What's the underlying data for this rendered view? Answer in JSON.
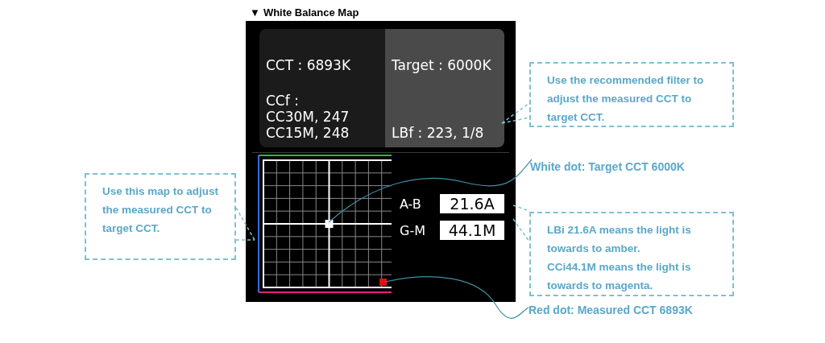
{
  "section": {
    "arrow": "▼",
    "title": "White Balance Map"
  },
  "readouts": [
    {
      "kind": "dark",
      "text": "CCT : 6893K"
    },
    {
      "kind": "light",
      "text": "Target : 6000K"
    },
    {
      "kind": "dark",
      "text": "CCf :\nCC30M, 247\nCC15M, 248"
    },
    {
      "kind": "light",
      "text": "LBf : 223, 1/8"
    }
  ],
  "axes": [
    {
      "label": "A-B",
      "value": "21.6A"
    },
    {
      "label": "G-M",
      "value": "44.1M"
    }
  ],
  "callouts": [
    {
      "kind": "box",
      "text": "Use the recommended filter to adjust the measured CCT to target CCT."
    },
    {
      "kind": "plain",
      "text": "White dot: Target CCT 6000K"
    },
    {
      "kind": "box",
      "text": "Use this map to adjust the measured CCT to target CCT."
    },
    {
      "kind": "box",
      "text": "LBi 21.6A means the light is towards to amber.\nCCi44.1M means the light is towards to magenta."
    },
    {
      "kind": "plain",
      "text": "Red dot: Measured CCT 6893K"
    }
  ]
}
